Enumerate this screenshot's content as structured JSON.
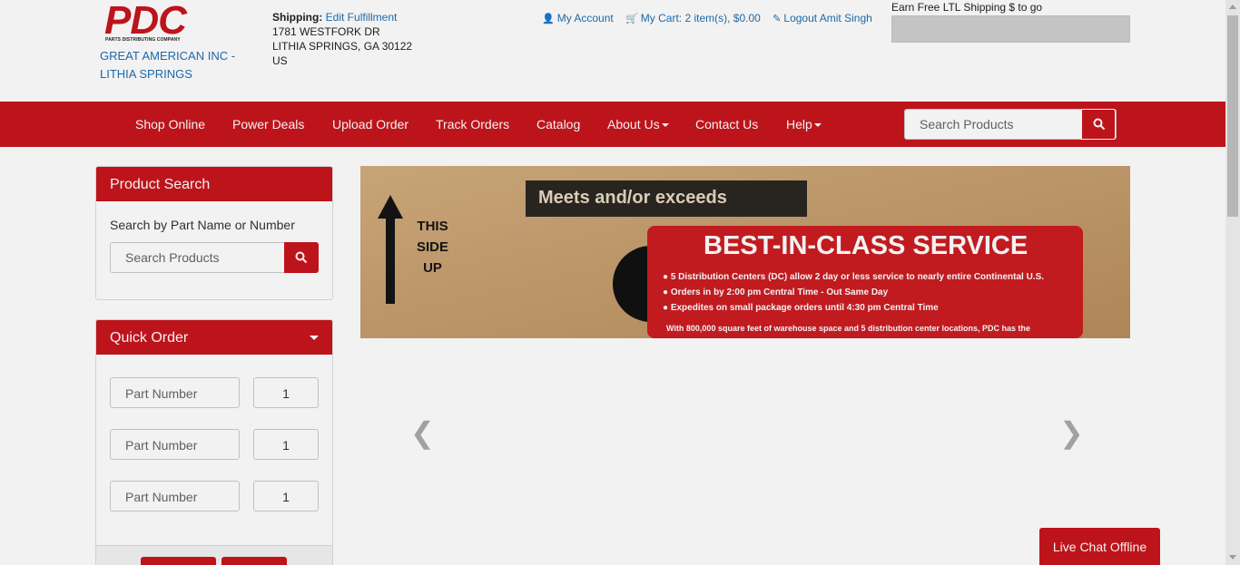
{
  "colors": {
    "brand_red": "#c8161d",
    "link_blue": "#1f6fb2"
  },
  "header": {
    "logo": {
      "text": "PDC",
      "subtext": "PARTS DISTRIBUTING COMPANY"
    },
    "company_name": "GREAT AMERICAN INC - LITHIA SPRINGS",
    "shipping": {
      "label": "Shipping:",
      "edit_link": "Edit Fulfillment",
      "address_line1": "1781 WESTFORK DR",
      "address_line2": "LITHIA SPRINGS, GA 30122",
      "country": "US"
    },
    "toplinks": {
      "my_account": "My Account",
      "my_cart": "My Cart: 2 item(s), $0.00",
      "logout": "Logout Amit Singh"
    },
    "ltl_text": "Earn Free LTL Shipping $ to go"
  },
  "nav": {
    "items": [
      {
        "label": "Shop Online"
      },
      {
        "label": "Power Deals"
      },
      {
        "label": "Upload Order"
      },
      {
        "label": "Track Orders"
      },
      {
        "label": "Catalog"
      },
      {
        "label": "About Us"
      },
      {
        "label": "Contact Us"
      },
      {
        "label": "Help"
      }
    ],
    "search_placeholder": "Search Products"
  },
  "product_search": {
    "title": "Product Search",
    "label": "Search by Part Name or Number",
    "placeholder": "Search Products"
  },
  "quick_order": {
    "title": "Quick Order",
    "rows": [
      {
        "part_placeholder": "Part Number",
        "qty": "1"
      },
      {
        "part_placeholder": "Part Number",
        "qty": "1"
      },
      {
        "part_placeholder": "Part Number",
        "qty": "1"
      }
    ]
  },
  "banner": {
    "box_label": "Meets and/or exceeds",
    "this_side_up": [
      "THIS",
      "SIDE",
      "UP"
    ],
    "heading": "BEST-IN-CLASS SERVICE",
    "bullets": [
      "5 Distribution Centers (DC) allow 2 day or less service to nearly entire Continental U.S.",
      "Orders in by 2:00 pm Central Time - Out Same Day",
      "Expedites on small package orders until 4:30 pm Central Time"
    ],
    "footer": "With 800,000 square feet of warehouse space and 5 distribution center locations, PDC has the"
  },
  "livechat": "Live Chat Offline"
}
